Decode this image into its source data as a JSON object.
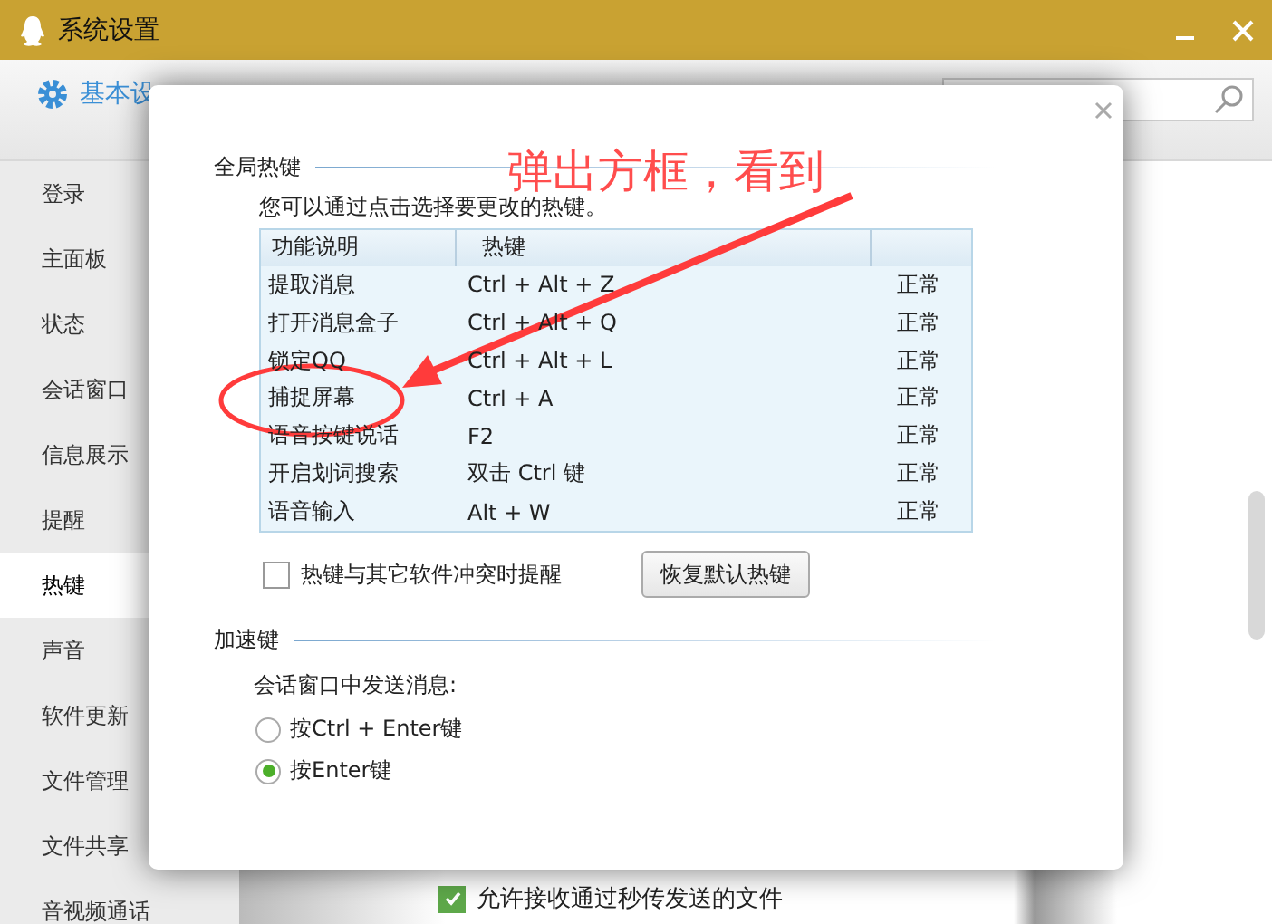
{
  "window": {
    "title": "系统设置"
  },
  "top_tabs": [
    {
      "label": "基本设",
      "selected": true
    }
  ],
  "sidebar": {
    "items": [
      {
        "label": "登录",
        "selected": false
      },
      {
        "label": "主面板",
        "selected": false
      },
      {
        "label": "状态",
        "selected": false
      },
      {
        "label": "会话窗口",
        "selected": false
      },
      {
        "label": "信息展示",
        "selected": false
      },
      {
        "label": "提醒",
        "selected": false
      },
      {
        "label": "热键",
        "selected": true
      },
      {
        "label": "声音",
        "selected": false
      },
      {
        "label": "软件更新",
        "selected": false
      },
      {
        "label": "文件管理",
        "selected": false
      },
      {
        "label": "文件共享",
        "selected": false
      },
      {
        "label": "音视频通话",
        "selected": false
      }
    ]
  },
  "background_option": {
    "label": "允许接收通过秒传发送的文件",
    "checked": true
  },
  "dialog": {
    "hotkeys": {
      "title": "全局热键",
      "description": "您可以通过点击选择要更改的热键。",
      "columns": [
        "功能说明",
        "热键"
      ],
      "rows": [
        {
          "name": "提取消息",
          "hotkey": "Ctrl + Alt + Z",
          "status": "正常"
        },
        {
          "name": "打开消息盒子",
          "hotkey": "Ctrl + Alt + Q",
          "status": "正常"
        },
        {
          "name": "锁定QQ",
          "hotkey": "Ctrl + Alt + L",
          "status": "正常"
        },
        {
          "name": "捕捉屏幕",
          "hotkey": "Ctrl + A",
          "status": "正常"
        },
        {
          "name": "语音按键说话",
          "hotkey": "F2",
          "status": "正常"
        },
        {
          "name": "开启划词搜索",
          "hotkey": "双击 Ctrl 键",
          "status": "正常"
        },
        {
          "name": "语音输入",
          "hotkey": "Alt + W",
          "status": "正常"
        }
      ],
      "conflict_alert": {
        "label": "热键与其它软件冲突时提醒",
        "checked": false
      },
      "restore_button": "恢复默认热键"
    },
    "accelerator": {
      "title": "加速键",
      "prompt": "会话窗口中发送消息:",
      "options": [
        {
          "label": "按Ctrl + Enter键",
          "selected": false
        },
        {
          "label": "按Enter键",
          "selected": true
        }
      ]
    }
  },
  "annotation": {
    "text": "弹出方框，看到"
  }
}
